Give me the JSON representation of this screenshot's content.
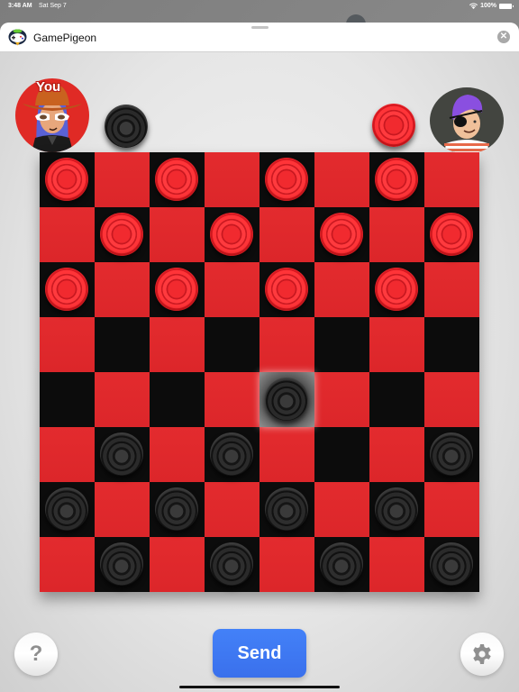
{
  "status_bar": {
    "time": "3:48 AM",
    "date": "Sat Sep 7",
    "battery": "100%"
  },
  "app": {
    "title": "GamePigeon",
    "close_icon": "close-icon",
    "logo_icon": "gamepigeon-logo"
  },
  "players": {
    "you": {
      "label": "You",
      "piece_color": "black",
      "avatar_bg": "#e02a25",
      "is_turn": true
    },
    "opponent": {
      "piece_color": "red",
      "avatar_bg": "#434540"
    }
  },
  "board": {
    "size": 8,
    "light_color": "#e32b2e",
    "dark_color": "#0c0c0c",
    "highlight": [
      4,
      4
    ],
    "pieces": [
      [
        "R",
        "",
        "R",
        "",
        "R",
        "",
        "R",
        ""
      ],
      [
        "",
        "R",
        "",
        "R",
        "",
        "R",
        "",
        "R"
      ],
      [
        "R",
        "",
        "R",
        "",
        "R",
        "",
        "R",
        ""
      ],
      [
        "",
        "",
        "",
        "",
        "",
        "",
        "",
        ""
      ],
      [
        "",
        "",
        "",
        "",
        "B",
        "",
        "",
        ""
      ],
      [
        "",
        "B",
        "",
        "B",
        "",
        "",
        "",
        "B"
      ],
      [
        "B",
        "",
        "B",
        "",
        "B",
        "",
        "B",
        ""
      ],
      [
        "",
        "B",
        "",
        "B",
        "",
        "B",
        "",
        "B"
      ]
    ]
  },
  "controls": {
    "help_label": "?",
    "send_label": "Send",
    "send_color": "#4381f8",
    "settings_icon": "gear-icon"
  }
}
